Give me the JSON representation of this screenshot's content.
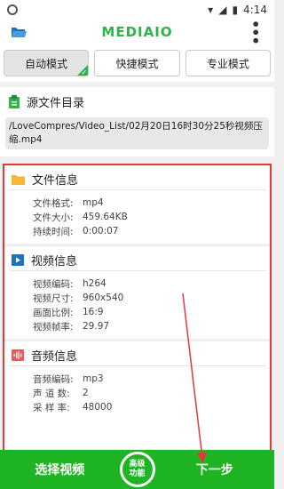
{
  "status": {
    "time": "4:14"
  },
  "appbar": {
    "logo": "MEDIAIO"
  },
  "tabs": [
    {
      "label": "自动模式",
      "active": true
    },
    {
      "label": "快捷模式",
      "active": false
    },
    {
      "label": "专业模式",
      "active": false
    }
  ],
  "source": {
    "title": "源文件目录",
    "path": "/LoveCompres/Video_List/02月20日16时30分25秒视频压缩.mp4"
  },
  "file_info": {
    "title": "文件信息",
    "rows": [
      {
        "key": "文件格式:",
        "value": "mp4"
      },
      {
        "key": "文件大小:",
        "value": "459.64KB"
      },
      {
        "key": "持续时间:",
        "value": "0:00:07"
      }
    ]
  },
  "video_info": {
    "title": "视频信息",
    "rows": [
      {
        "key": "视频编码:",
        "value": "h264"
      },
      {
        "key": "视频尺寸:",
        "value": "960x540"
      },
      {
        "key": "画面比例:",
        "value": "16:9"
      },
      {
        "key": "视频帧率:",
        "value": "29.97"
      }
    ]
  },
  "audio_info": {
    "title": "音频信息",
    "rows": [
      {
        "key": "音频编码:",
        "value": "mp3"
      },
      {
        "key": "声 道 数:",
        "value": "2"
      },
      {
        "key": "采 样 率:",
        "value": "48000"
      }
    ]
  },
  "bottom": {
    "select_label": "选择视频",
    "advanced_label": "高级\n功能",
    "next_label": "下一步"
  },
  "colors": {
    "brand": "#1fb424",
    "highlight_border": "#e53935"
  }
}
